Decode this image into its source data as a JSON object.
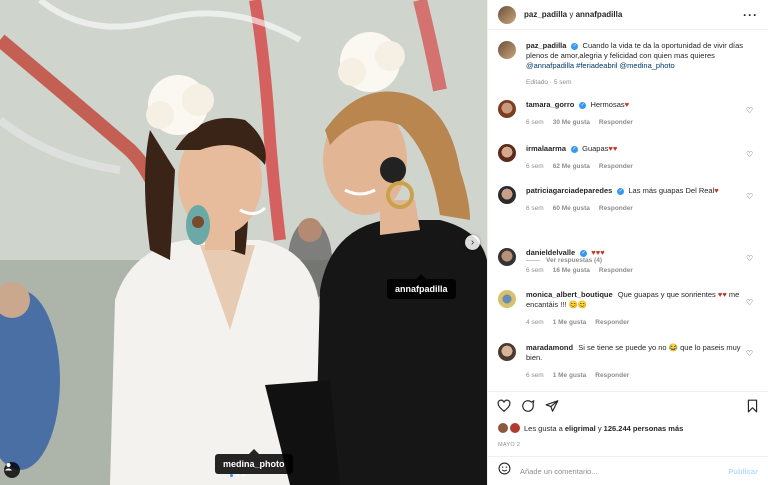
{
  "post": {
    "author": "paz_padilla",
    "connector": "y",
    "coauthor": "annafpadilla",
    "more_icon": "more-horizontal-icon"
  },
  "photo": {
    "tags": [
      "annafpadilla",
      "medina_photo"
    ],
    "next_icon": "chevron-right-icon",
    "user_tag_icon": "person-icon"
  },
  "caption": {
    "user": "paz_padilla",
    "text": "Cuando la vida te da la oportunidad de vivir días plenos de amor,alegria y felicidad con quien mas quieres",
    "mention": "@annafpadilla",
    "hashtag": "#feriadeabril",
    "mention2": "@medina_photo",
    "edited": "Editado · 5 sem"
  },
  "comments": [
    {
      "user": "tamara_gorro",
      "verified": true,
      "text": "Hermosas",
      "hearts": 1,
      "time": "6 sem",
      "likes": "30 Me gusta",
      "reply": "Responder"
    },
    {
      "user": "irmalaarma",
      "verified": true,
      "text": "Guapas",
      "hearts": 2,
      "time": "6 sem",
      "likes": "62 Me gusta",
      "reply": "Responder"
    },
    {
      "user": "patriciagarciadeparedes",
      "verified": true,
      "text": "Las más guapas Del Real",
      "hearts": 1,
      "time": "6 sem",
      "likes": "60 Me gusta",
      "reply": "Responder",
      "view_replies": "Ver respuestas (4)"
    },
    {
      "user": "danieldelvalle",
      "verified": true,
      "text": "",
      "hearts": 3,
      "time": "6 sem",
      "likes": "16 Me gusta",
      "reply": "Responder"
    },
    {
      "user": "monica_albert_boutique",
      "verified": false,
      "text": "Que guapas y que sonrientes",
      "hearts": 2,
      "text2": "me encantáis !!! 😊😊",
      "time": "4 sem",
      "likes": "1 Me gusta",
      "reply": "Responder"
    },
    {
      "user": "maradamond",
      "verified": false,
      "text": "Si se tiene se puede yo no 😂 que lo paseis muy bien.",
      "hearts": 0,
      "time": "6 sem",
      "likes": "1 Me gusta",
      "reply": "Responder"
    }
  ],
  "actions": {
    "icons": [
      "heart-icon",
      "comment-icon",
      "share-icon",
      "bookmark-icon"
    ],
    "likes_prefix": "Les gusta a",
    "likes_user": "eligrimal",
    "likes_mid": "y",
    "likes_count": "126.244 personas más",
    "date": "MAYO 2"
  },
  "add_comment": {
    "placeholder": "Añade un comentario...",
    "publish": "Publicar",
    "emoji_icon": "smiley-icon"
  }
}
